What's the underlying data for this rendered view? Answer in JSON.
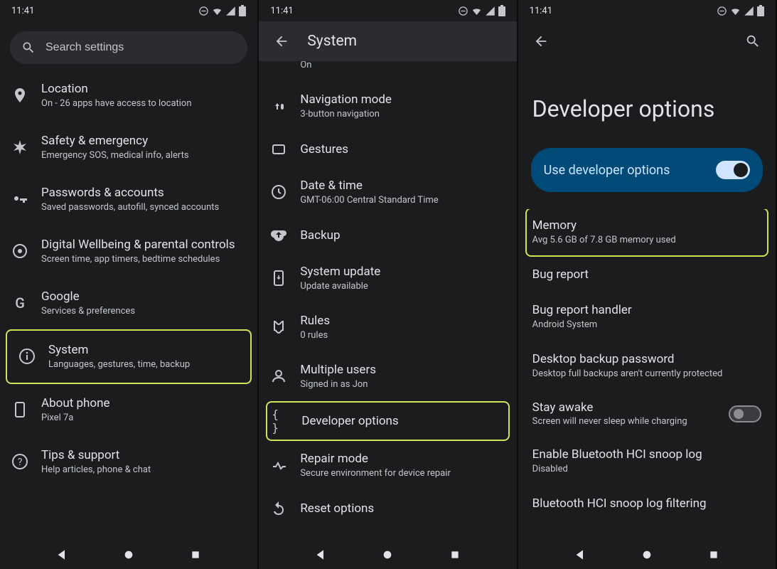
{
  "status": {
    "time": "11:41"
  },
  "panel1": {
    "search_placeholder": "Search settings",
    "items": [
      {
        "icon": "location",
        "title": "Location",
        "subtitle": "On - 26 apps have access to location"
      },
      {
        "icon": "asterisk",
        "title": "Safety & emergency",
        "subtitle": "Emergency SOS, medical info, alerts"
      },
      {
        "icon": "key",
        "title": "Passwords & accounts",
        "subtitle": "Saved passwords, autofill, synced accounts"
      },
      {
        "icon": "wellbeing",
        "title": "Digital Wellbeing & parental controls",
        "subtitle": "Screen time, app timers, bedtime schedules"
      },
      {
        "icon": "google",
        "title": "Google",
        "subtitle": "Services & preferences"
      },
      {
        "icon": "info",
        "title": "System",
        "subtitle": "Languages, gestures, time, backup",
        "highlight": true
      },
      {
        "icon": "phone",
        "title": "About phone",
        "subtitle": "Pixel 7a"
      },
      {
        "icon": "help",
        "title": "Tips & support",
        "subtitle": "Help articles, phone & chat"
      }
    ]
  },
  "panel2": {
    "title": "System",
    "cutoff_subtitle": "On",
    "items": [
      {
        "icon": "gesture",
        "title": "Navigation mode",
        "subtitle": "3-button navigation"
      },
      {
        "icon": "rect",
        "title": "Gestures",
        "subtitle": ""
      },
      {
        "icon": "clock",
        "title": "Date & time",
        "subtitle": "GMT-06:00 Central Standard Time"
      },
      {
        "icon": "backup",
        "title": "Backup",
        "subtitle": ""
      },
      {
        "icon": "update",
        "title": "System update",
        "subtitle": "Update available"
      },
      {
        "icon": "rules",
        "title": "Rules",
        "subtitle": "0 rules"
      },
      {
        "icon": "users",
        "title": "Multiple users",
        "subtitle": "Signed in as Jon"
      },
      {
        "icon": "braces",
        "title": "Developer options",
        "subtitle": "",
        "highlight": true
      },
      {
        "icon": "repair",
        "title": "Repair mode",
        "subtitle": "Secure environment for device repair"
      },
      {
        "icon": "reset",
        "title": "Reset options",
        "subtitle": ""
      }
    ]
  },
  "panel3": {
    "page_title": "Developer options",
    "toggle_label": "Use developer options",
    "toggle_on": true,
    "items": [
      {
        "title": "Memory",
        "subtitle": "Avg 5.6 GB of 7.8 GB memory used",
        "highlight": true
      },
      {
        "title": "Bug report",
        "subtitle": ""
      },
      {
        "title": "Bug report handler",
        "subtitle": "Android System"
      },
      {
        "title": "Desktop backup password",
        "subtitle": "Desktop full backups aren't currently protected"
      },
      {
        "title": "Stay awake",
        "subtitle": "Screen will never sleep while charging",
        "switch": "off"
      },
      {
        "title": "Enable Bluetooth HCI snoop log",
        "subtitle": "Disabled"
      },
      {
        "title": "Bluetooth HCI snoop log filtering",
        "subtitle": ""
      }
    ]
  }
}
